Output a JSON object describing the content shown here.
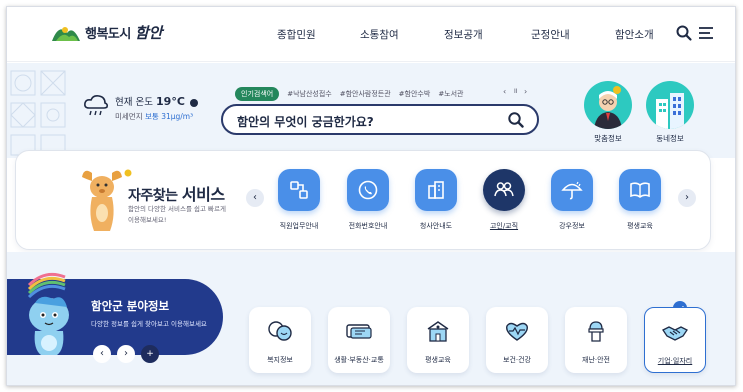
{
  "header": {
    "logo_text": "행복도시",
    "logo_script": "함안",
    "nav": [
      "종합민원",
      "소통참여",
      "정보공개",
      "군정안내",
      "함안소개"
    ],
    "icons": [
      "search-icon",
      "menu-icon"
    ]
  },
  "weather": {
    "label": "현재 온도",
    "temp": "19°C",
    "dust_label": "미세먼지",
    "dust_status": "보통",
    "dust_value": "31μg/m³"
  },
  "search": {
    "badge": "인기검색어",
    "keywords": [
      "#낙남산성접수",
      "#함안사람정든관",
      "#함안수박",
      "#노서관"
    ],
    "controls": [
      "‹",
      "II",
      "›"
    ],
    "placeholder": "함안의 무엇이 궁금한가요?"
  },
  "quick_links": [
    {
      "label": "맞춤정보"
    },
    {
      "label": "동네정보"
    }
  ],
  "services": {
    "title_a": "자주찾는",
    "title_b": "서비스",
    "desc": "함안의 다양한 서비스를 쉽고 빠르게 이용해보세요!",
    "items": [
      {
        "label": "직원업무안내",
        "icon": "org-chart-icon"
      },
      {
        "label": "전화번호안내",
        "icon": "phone-icon"
      },
      {
        "label": "청사안내도",
        "icon": "building-icon"
      },
      {
        "label": "고인/교직",
        "icon": "people-icon",
        "active": true
      },
      {
        "label": "강우정보",
        "icon": "umbrella-icon"
      },
      {
        "label": "평생교육",
        "icon": "book-icon"
      }
    ]
  },
  "sector": {
    "title": "함안군 분야정보",
    "desc": "다양한 정보를 쉽게 찾아보고 이용해보세요",
    "controls": [
      "‹",
      "›",
      "+"
    ]
  },
  "categories": [
    {
      "label": "복지정보",
      "icon": "welfare-icon"
    },
    {
      "label": "생활·부동산·교통",
      "icon": "ticket-icon"
    },
    {
      "label": "평생교육",
      "icon": "school-icon"
    },
    {
      "label": "보건·건강",
      "icon": "heart-icon"
    },
    {
      "label": "재난·안전",
      "icon": "safety-icon"
    },
    {
      "label": "기업·일자리",
      "icon": "handshake-icon",
      "active": true
    }
  ],
  "colors": {
    "navy": "#1f2a44",
    "blue": "#4a8fe8",
    "dark_blue": "#223a8c",
    "green": "#24875c",
    "bg": "#eef4fb"
  }
}
